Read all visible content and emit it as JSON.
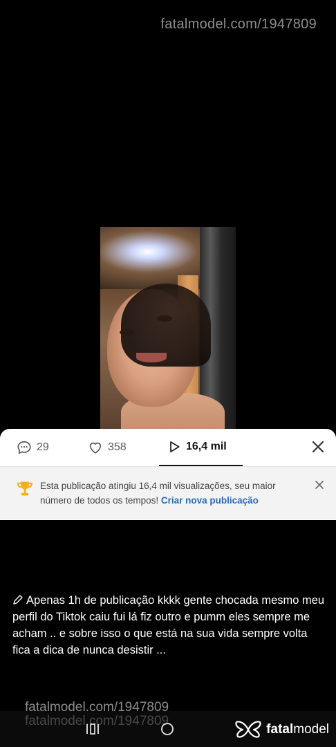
{
  "watermark": {
    "top": "fatalmodel.com/1947809",
    "bottom_line1": "fatalmodel.com/1947809",
    "bottom_line2": "fatalmodel.com/1947809"
  },
  "stats": {
    "comments": "29",
    "likes": "358",
    "views": "16,4 mil"
  },
  "notice": {
    "text": "Esta publicação atingiu 16,4 mil visualizações, seu maior número de todos os tempos!",
    "link": "Criar nova publicação"
  },
  "caption": "Apenas 1h de publicação kkkk gente chocada mesmo meu perfil do Tiktok caiu fui lá fiz outro e pumm eles sempre me acham .. e sobre isso o que está na sua vida sempre volta fica a dica de nunca desistir ...",
  "brand": {
    "part1": "fatal",
    "part2": "model"
  },
  "icons": {
    "comment": "comment-icon",
    "like": "heart-icon",
    "views": "play-icon",
    "close": "close-icon",
    "trophy": "trophy-icon",
    "pencil": "pencil-icon"
  },
  "colors": {
    "link": "#2b6cb0",
    "trophy": "#f2b01e"
  }
}
